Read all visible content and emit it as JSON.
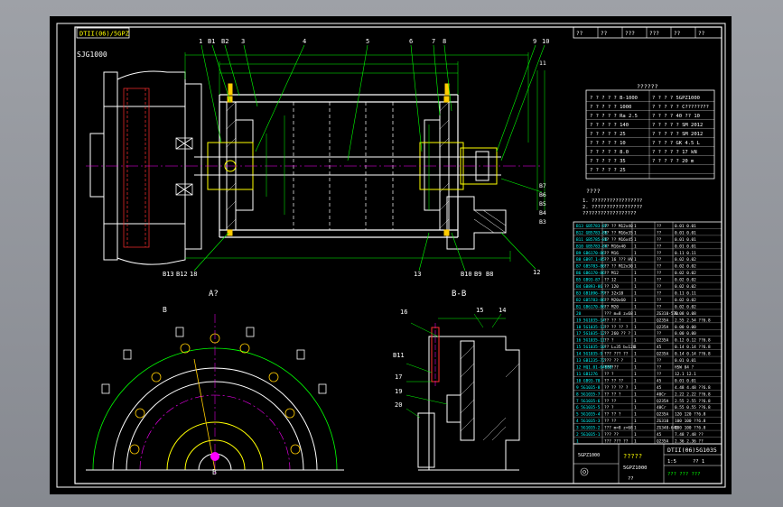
{
  "title_tag": "DTII(06)/5GPZ",
  "model_label": "SJG1000",
  "top_callouts": [
    "1",
    "B1",
    "B2",
    "3",
    "4",
    "5",
    "6",
    "7",
    "8",
    "9",
    "10"
  ],
  "bottom_callouts": [
    "B13",
    "B12",
    "18",
    "13",
    "B10",
    "B9",
    "B8",
    "12"
  ],
  "right_callouts": [
    "11",
    "B7",
    "B6",
    "B5",
    "B4",
    "B3"
  ],
  "section_a_label": "A?",
  "section_b_label": "B-B",
  "section_a_marks": [
    "B",
    "B"
  ],
  "section_b_callouts": [
    "16",
    "15",
    "14",
    "B11",
    "17",
    "19",
    "20"
  ],
  "tech_header": "??????",
  "tech_rows": [
    [
      "? ? ? ? ?  B-1000",
      "? ? ? ?  5GPZ1000"
    ],
    [
      "? ? ? ? ?  1000",
      "? ? ? ? ?  C????????"
    ],
    [
      "? ? ? ? ?  Ra 2.5",
      "? ? ? ?  40   ?? 10"
    ],
    [
      "? ? ? ? ?  140",
      "? ? ? ? ?  SM 2012"
    ],
    [
      "? ? ? ? ?  25",
      "? ? ? ? ?  SM 2012"
    ],
    [
      "? ? ? ? ?  10",
      "? ? ? ?  GK 4.5 L"
    ],
    [
      "? ? ? ? ?  8.0",
      "? ? ? ? ?  17 kN"
    ],
    [
      "? ? ? ? ?  35",
      "? ? ? ? ?  20 m"
    ],
    [
      "? ? ? ? ?  25",
      ""
    ]
  ],
  "notes_header": "????",
  "notes": [
    "1. ?????????????????",
    "2. ?????????????????",
    "   ??????????????????"
  ],
  "parts_rows": [
    [
      "B13",
      "GB5783-87",
      "?? ?? M12x40",
      "1",
      "??",
      "0.01 0.01"
    ],
    [
      "B12",
      "GB5783-86",
      "?? ?? M16x35",
      "1",
      "??",
      "0.01 0.01"
    ],
    [
      "B11",
      "GB5785-86",
      "?? ?? M16x45",
      "1",
      "??",
      "0.01 0.01"
    ],
    [
      "B10",
      "GB5783-84",
      "?? M16x40",
      "1",
      "??",
      "0.01 0.01"
    ],
    [
      "B9",
      "GB6170-86",
      "?? M16",
      "1",
      "??",
      "0.11 0.11"
    ],
    [
      "B8",
      "GB97.1-85",
      "?? 16 ??? HV",
      "1",
      "??",
      "0.02 0.02"
    ],
    [
      "B7",
      "GB5783-86",
      "?? ?? M12x30",
      "1",
      "??",
      "0.02 0.02"
    ],
    [
      "B6",
      "GB6170-86",
      "?? M12",
      "1",
      "??",
      "0.02 0.02"
    ],
    [
      "B5",
      "GB93-87",
      "?? 12",
      "1",
      "??",
      "0.02 0.02"
    ],
    [
      "B4",
      "GB893-86",
      "?? 120",
      "1",
      "??",
      "0.02 0.02"
    ],
    [
      "B3",
      "GB1096-79",
      "?? 32x18",
      "1",
      "??",
      "0.11 0.11"
    ],
    [
      "B2",
      "GB5783-86",
      "?? M20x60",
      "1",
      "??",
      "0.02 0.02"
    ],
    [
      "B1",
      "GB6170-86",
      "?? M20",
      "1",
      "??",
      "0.02 0.02"
    ]
  ],
  "parts_rows2": [
    [
      "20",
      "",
      "??? m=8 z=68",
      "1",
      "ZG310-570",
      "0.08 0.08"
    ],
    [
      "19",
      "5G1035-14",
      "?? ?? ?",
      "1",
      "Q235A",
      "2.55 2.54 ??6.8"
    ],
    [
      "18",
      "5G1035-13",
      "?? ?? ?? ?",
      "1",
      "Q235A",
      "0.00 0.00"
    ],
    [
      "17",
      "5G1035-12",
      "?? 260 ?? ?",
      "1",
      "??",
      "0.00 0.00"
    ],
    [
      "16",
      "5G1035-11",
      "?? ?",
      "1",
      "Q235A",
      "0.12 0.12 ??6.8"
    ],
    [
      "15",
      "5G1035-10",
      "?? L=35 b=120",
      "1",
      "45",
      "0.14 0.14 ??6.8"
    ],
    [
      "14",
      "5G1035-9",
      "??? ??? ??",
      "1",
      "Q235A",
      "0.14 0.14 ??6.8"
    ],
    [
      "13",
      "GB1235-72",
      "??? ?? ?",
      "1",
      "??",
      "0.01 0.01"
    ],
    [
      "12",
      "HQ1.01-04000",
      "??????",
      "1",
      "??",
      "HSW 04 ?"
    ],
    [
      "11",
      "GB1276",
      "?? ?",
      "1",
      "??",
      "12.1 12.1"
    ],
    [
      "10",
      "GB93-70",
      "?? ?? ??",
      "1",
      "45",
      "0.01 0.01"
    ],
    [
      "9",
      "5G1035-8",
      "?? ?? ?? ?",
      "1",
      "45",
      "4.48 4.48 ??6.8"
    ],
    [
      "8",
      "5G1035-7",
      "?? ?? ?",
      "1",
      "40Cr",
      "2.22 2.22 ??6.8"
    ],
    [
      "7",
      "5G1035-6",
      "?? ??",
      "1",
      "Q235A",
      "2.55 2.55 ??6.8"
    ],
    [
      "6",
      "5G1035-5",
      "?? ?",
      "1",
      "40Cr",
      "0.55 0.55 ??6.8"
    ],
    [
      "5",
      "5G1035-4",
      "?? ?? ?",
      "1",
      "Q235A",
      "120 120 ??6.8"
    ],
    [
      "4",
      "5G1035-3",
      "?? ??",
      "1",
      "ZG310",
      "100 100 ??6.8"
    ],
    [
      "3",
      "5G1035-2",
      "??? m=8 z=68",
      "1",
      "ZG340-640",
      "100 100 ??6.8"
    ],
    [
      "2",
      "5G1035-1",
      "??? ??",
      "1",
      "45",
      "7.48 7.48 ??"
    ],
    [
      "1",
      "",
      "??? ??? ??",
      "1",
      "Q235A",
      "2.36 2.36 ??"
    ]
  ],
  "title_block": {
    "name": "?????",
    "drawing_no": "5GPZ1000",
    "code": "DTII(06)5G1035",
    "sheet": "??  1",
    "scale": "1:5",
    "weight": "5GPZ1000",
    "org": "??? ??? ???",
    "part_label": "??"
  },
  "header_strip": [
    "??",
    "??",
    "???",
    "???",
    "??",
    "??"
  ],
  "colors": {
    "outline": "#ffffff",
    "frame": "#ffffff",
    "parts": "#ffff00",
    "center": "#ff00ff",
    "dims": "#00ff00",
    "hatch": "#ffffff",
    "callout": "#00ffff",
    "bolt": "#ffcc00",
    "red": "#ff3030",
    "blue": "#3a6bff"
  }
}
